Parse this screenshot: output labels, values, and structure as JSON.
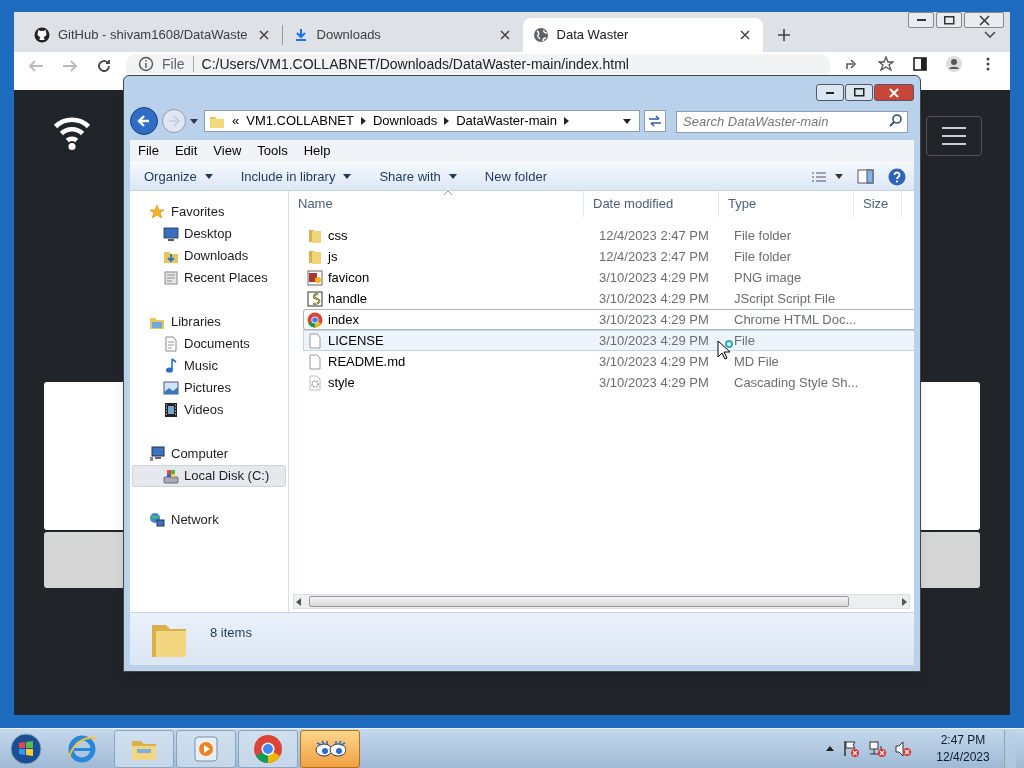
{
  "browser": {
    "tabs": [
      {
        "title": "GitHub - shivam1608/DataWaste",
        "selected": false
      },
      {
        "title": "Downloads",
        "selected": false
      },
      {
        "title": "Data Waster",
        "selected": true
      }
    ],
    "address": {
      "scheme": "File",
      "url": "C:/Users/VM1.COLLABNET/Downloads/DataWaster-main/index.html"
    }
  },
  "explorer": {
    "breadcrumb": [
      "«",
      "VM1.COLLABNET",
      "Downloads",
      "DataWaster-main"
    ],
    "search": {
      "placeholder": "Search DataWaster-main"
    },
    "menu": [
      "File",
      "Edit",
      "View",
      "Tools",
      "Help"
    ],
    "commands": [
      {
        "label": "Organize",
        "dropdown": true
      },
      {
        "label": "Include in library",
        "dropdown": true
      },
      {
        "label": "Share with",
        "dropdown": true
      },
      {
        "label": "New folder",
        "dropdown": false
      }
    ],
    "sidebar": [
      {
        "label": "Favorites",
        "children": [
          {
            "label": "Desktop",
            "selected": false
          },
          {
            "label": "Downloads",
            "selected": false
          },
          {
            "label": "Recent Places",
            "selected": false
          }
        ]
      },
      {
        "label": "Libraries",
        "children": [
          {
            "label": "Documents",
            "selected": false
          },
          {
            "label": "Music",
            "selected": false
          },
          {
            "label": "Pictures",
            "selected": false
          },
          {
            "label": "Videos",
            "selected": false
          }
        ]
      },
      {
        "label": "Computer",
        "children": [
          {
            "label": "Local Disk (C:)",
            "selected": true
          }
        ]
      },
      {
        "label": "Network"
      }
    ],
    "columns": [
      "Name",
      "Date modified",
      "Type",
      "Size"
    ],
    "files": [
      {
        "name": "css",
        "kind": "folder",
        "date": "12/4/2023 2:47 PM",
        "type": "File folder",
        "selected": false,
        "hovered": false
      },
      {
        "name": "js",
        "kind": "folder",
        "date": "12/4/2023 2:47 PM",
        "type": "File folder",
        "selected": false,
        "hovered": false
      },
      {
        "name": "favicon",
        "kind": "image",
        "date": "3/10/2023 4:29 PM",
        "type": "PNG image",
        "selected": false,
        "hovered": false
      },
      {
        "name": "handle",
        "kind": "script",
        "date": "3/10/2023 4:29 PM",
        "type": "JScript Script File",
        "selected": false,
        "hovered": false
      },
      {
        "name": "index",
        "kind": "html",
        "date": "3/10/2023 4:29 PM",
        "type": "Chrome HTML Doc...",
        "selected": true,
        "hovered": false
      },
      {
        "name": "LICENSE",
        "kind": "file",
        "date": "3/10/2023 4:29 PM",
        "type": "File",
        "selected": false,
        "hovered": true
      },
      {
        "name": "README.md",
        "kind": "file",
        "date": "3/10/2023 4:29 PM",
        "type": "MD File",
        "selected": false,
        "hovered": false
      },
      {
        "name": "style",
        "kind": "css",
        "date": "3/10/2023 4:29 PM",
        "type": "Cascading Style Sh...",
        "selected": false,
        "hovered": false
      }
    ],
    "item_count": "8 items"
  },
  "taskbar": {
    "apps": [
      {
        "active": false
      },
      {
        "active": false
      },
      {
        "active": false
      },
      {
        "active": false
      },
      {
        "active": true
      }
    ],
    "time": "2:47 PM",
    "date": "12/4/2023"
  }
}
